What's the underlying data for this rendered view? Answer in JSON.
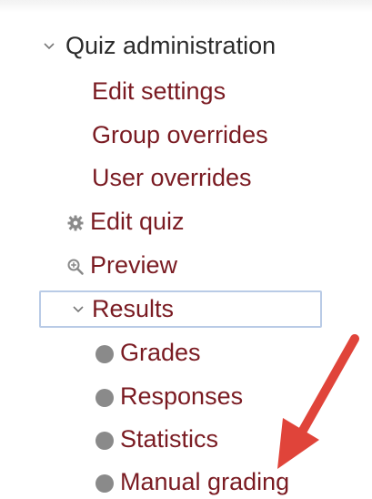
{
  "nav": {
    "root_label": "Quiz administration",
    "items": [
      {
        "label": "Edit settings"
      },
      {
        "label": "Group overrides"
      },
      {
        "label": "User overrides"
      },
      {
        "label": "Edit quiz",
        "icon": "gear-icon"
      },
      {
        "label": "Preview",
        "icon": "magnifier-plus-icon"
      },
      {
        "label": "Results",
        "icon": "chevron-down-icon",
        "expanded": true
      }
    ],
    "results_children": [
      {
        "label": "Grades"
      },
      {
        "label": "Responses"
      },
      {
        "label": "Statistics"
      },
      {
        "label": "Manual grading"
      }
    ]
  },
  "colors": {
    "link": "#7a1b22",
    "root_text": "#2b2b2b",
    "focus_border": "#b9cbe6",
    "bullet": "#8a8a8a",
    "annotation_arrow": "#e0443a"
  },
  "annotation": {
    "icon": "red-arrow-icon",
    "points_to": "Manual grading"
  }
}
